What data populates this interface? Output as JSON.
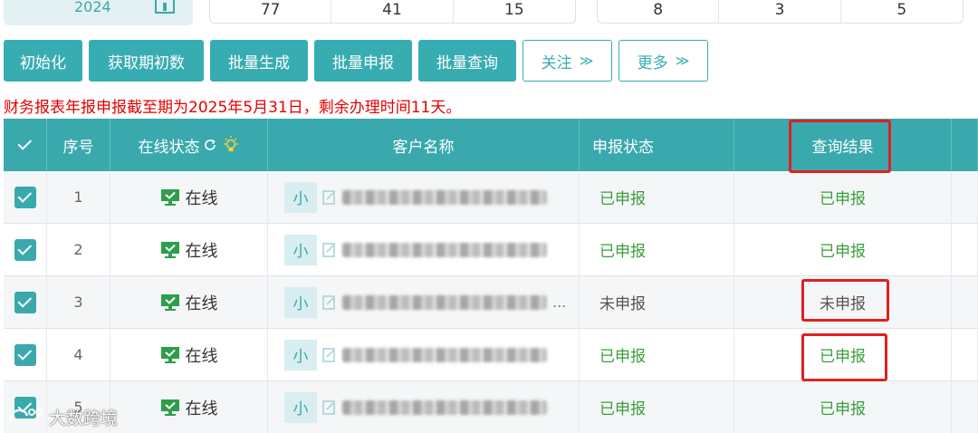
{
  "stats": {
    "year": "2024",
    "group_a": [
      "77",
      "41",
      "15"
    ],
    "group_b": [
      "8",
      "3",
      "5"
    ]
  },
  "toolbar": {
    "init": "初始化",
    "fetch_initial": "获取期初数",
    "batch_generate": "批量生成",
    "batch_declare": "批量申报",
    "batch_query": "批量查询",
    "follow": "关注",
    "more": "更多",
    "chevron": "≫"
  },
  "notice": "财务报表年报申报截至期为2025年5月31日，剩余办理时间11天。",
  "table": {
    "headers": {
      "index": "序号",
      "online_status": "在线状态",
      "customer_name": "客户名称",
      "declare_status": "申报状态",
      "query_result": "查询结果"
    },
    "rows": [
      {
        "index": "1",
        "online": "在线",
        "tag": "小",
        "declare": "已申报",
        "result": "已申报"
      },
      {
        "index": "2",
        "online": "在线",
        "tag": "小",
        "declare": "已申报",
        "result": "已申报"
      },
      {
        "index": "3",
        "online": "在线",
        "tag": "小",
        "declare": "未申报",
        "result": "未申报",
        "name_suffix": "..."
      },
      {
        "index": "4",
        "online": "在线",
        "tag": "小",
        "declare": "已申报",
        "result": "已申报"
      },
      {
        "index": "5",
        "online": "在线",
        "tag": "小",
        "declare": "已申报",
        "result": "已申报"
      }
    ]
  },
  "watermark": "大数跨境",
  "colors": {
    "accent": "#3aa9ad",
    "done": "#3b9e3b",
    "alert": "#e60000",
    "highlight": "#e02020"
  }
}
